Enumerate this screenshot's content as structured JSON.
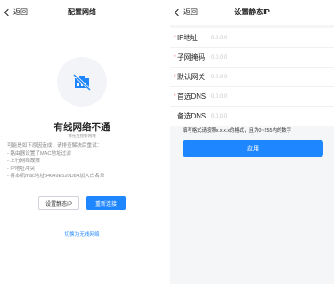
{
  "left": {
    "back_label": "返回",
    "title": "配置网络",
    "status_title": "有线网络不通",
    "status_sub": "请先连接好网线",
    "reasons": [
      "可能是如下原因造成，请排查解决后重试：",
      "- 路由器设置了MAC地址过滤",
      "- 上行网络故障",
      "- IP地址冲突",
      "- 将本机mac地址34649E520D8A加入白名单"
    ],
    "static_ip_button": "设置静态IP",
    "reconnect_button": "重新连接",
    "switch_wireless_link": "切换为无线网络",
    "accent_color": "#1e86ff"
  },
  "right": {
    "back_label": "返回",
    "title": "设置静态IP",
    "fields": [
      {
        "required": true,
        "label": "IP地址",
        "placeholder": "0.0.0.0"
      },
      {
        "required": true,
        "label": "子网掩码",
        "placeholder": "0.0.0.0"
      },
      {
        "required": true,
        "label": "默认网关",
        "placeholder": "0.0.0.0"
      },
      {
        "required": true,
        "label": "首选DNS",
        "placeholder": "0.0.0.0"
      },
      {
        "required": false,
        "label": "备选DNS",
        "placeholder": "0.0.0.0"
      }
    ],
    "hint": "填写格式请按照x.x.x.x的格式，且为0~255内的数字",
    "apply_button": "应用"
  }
}
